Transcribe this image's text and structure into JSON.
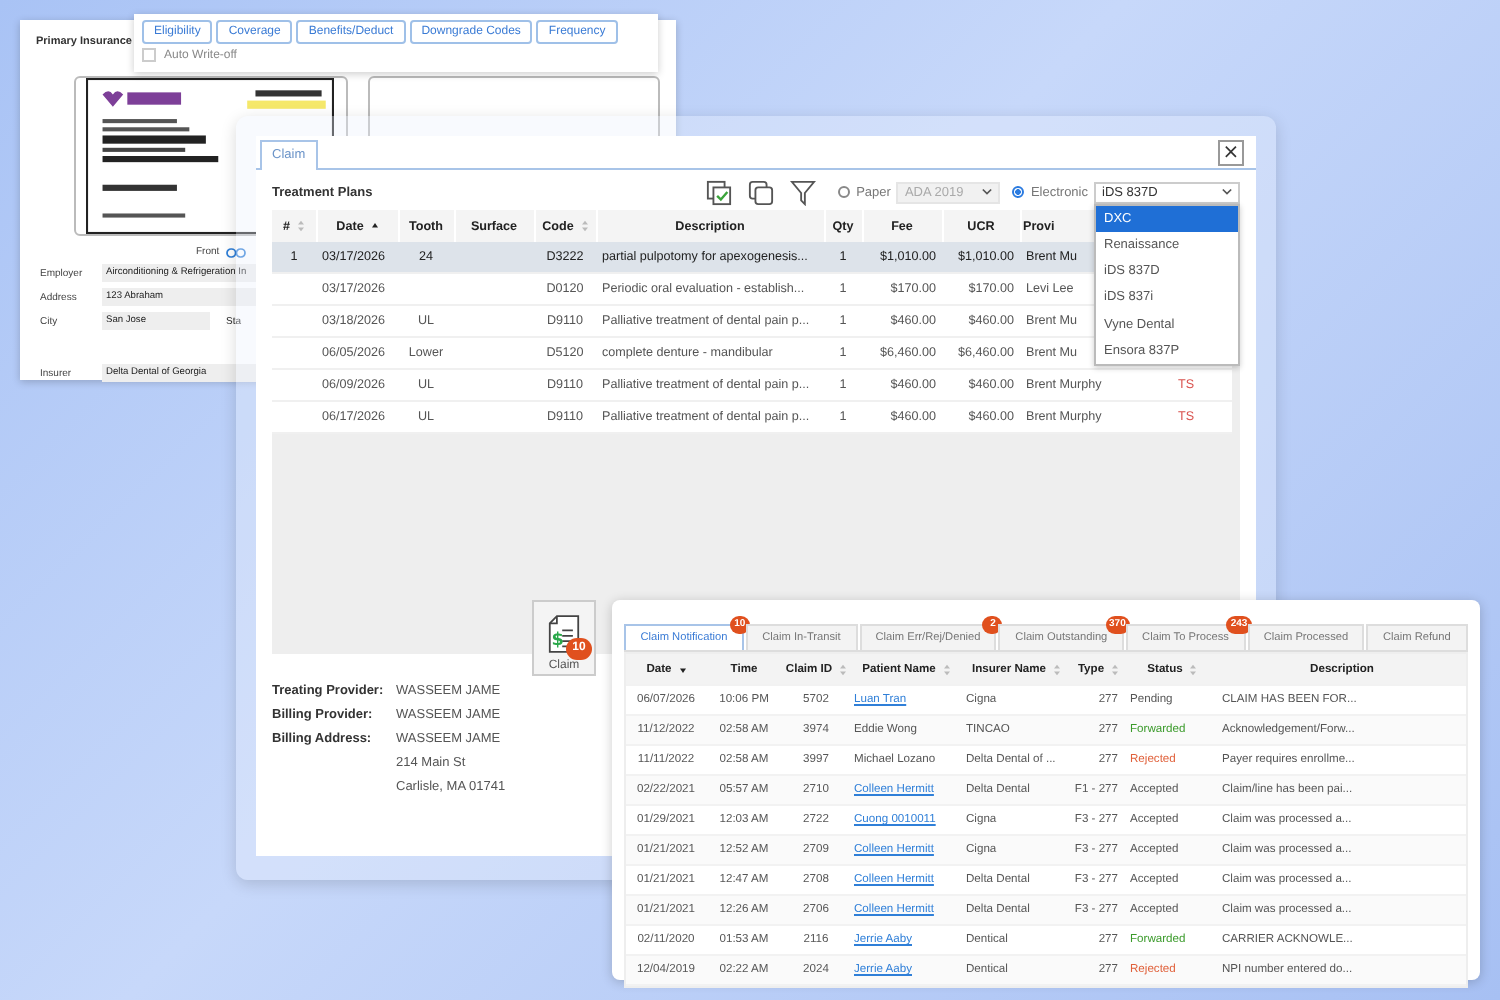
{
  "insurance": {
    "title": "Primary Insurance",
    "card_side": "Front",
    "fields": [
      {
        "label": "Employer",
        "value": "Airconditioning & Refrigeration In"
      },
      {
        "label": "Address",
        "value": "123 Abraham"
      },
      {
        "label": "City",
        "value": "San Jose",
        "extra_label": "Sta"
      },
      {
        "label": "Insurer",
        "value": "Delta Dental of Georgia"
      }
    ]
  },
  "toolbar": {
    "buttons": [
      "Eligibility",
      "Coverage",
      "Benefits/Deduct",
      "Downgrade Codes",
      "Frequency"
    ],
    "auto_writeoff": {
      "label": "Auto Write-off",
      "checked": false
    }
  },
  "claim_dialog": {
    "tab": {
      "label": "Claim",
      "selected": true
    },
    "close": "×",
    "section_title": "Treatment Plans",
    "format": [
      {
        "label": "Paper",
        "selected": false,
        "select": "ADA 2019"
      },
      {
        "label": "Electronic",
        "selected": true,
        "select": "iDS 837D"
      }
    ],
    "dropdown": [
      {
        "label": "DXC",
        "selected": true
      },
      {
        "label": "Renaissance",
        "selected": false
      },
      {
        "label": "iDS 837D",
        "selected": false
      },
      {
        "label": "iDS 837i",
        "selected": false
      },
      {
        "label": "Vyne Dental",
        "selected": false
      },
      {
        "label": "Ensora 837P",
        "selected": false
      }
    ],
    "columns": [
      "#",
      "Date",
      "Tooth",
      "Surface",
      "Code",
      "Description",
      "Qty",
      "Fee",
      "UCR",
      "Provi"
    ],
    "rows": [
      {
        "selected": true,
        "cells": [
          "1",
          "03/17/2026",
          "24",
          "",
          "D3222",
          "partial pulpotomy for apexogenesis...",
          "1",
          "$1,010.00",
          "$1,010.00",
          "Brent Mu",
          ""
        ]
      },
      {
        "selected": false,
        "cells": [
          "",
          "03/17/2026",
          "",
          "",
          "D0120",
          "Periodic oral evaluation - establish...",
          "1",
          "$170.00",
          "$170.00",
          "Levi Lee",
          ""
        ]
      },
      {
        "selected": false,
        "cells": [
          "",
          "03/18/2026",
          "UL",
          "",
          "D9110",
          "Palliative treatment of dental pain p...",
          "1",
          "$460.00",
          "$460.00",
          "Brent Mu",
          ""
        ]
      },
      {
        "selected": false,
        "cells": [
          "",
          "06/05/2026",
          "Lower",
          "",
          "D5120",
          "complete denture - mandibular",
          "1",
          "$6,460.00",
          "$6,460.00",
          "Brent Mu",
          ""
        ]
      },
      {
        "selected": false,
        "cells": [
          "",
          "06/09/2026",
          "UL",
          "",
          "D9110",
          "Palliative treatment of dental pain p...",
          "1",
          "$460.00",
          "$460.00",
          "Brent Murphy",
          "TS"
        ]
      },
      {
        "selected": false,
        "cells": [
          "",
          "06/17/2026",
          "UL",
          "",
          "D9110",
          "Palliative treatment of dental pain p...",
          "1",
          "$460.00",
          "$460.00",
          "Brent Murphy",
          "TS"
        ]
      }
    ],
    "claim_button": {
      "label": "Claim",
      "badge": "10",
      "icon_mark": "$"
    },
    "provider_info": [
      {
        "label": "Treating Provider:",
        "lines": [
          "WASSEEM JAME"
        ]
      },
      {
        "label": "Billing Provider:",
        "lines": [
          "WASSEEM JAME"
        ]
      },
      {
        "label": "Billing Address:",
        "lines": [
          "WASSEEM JAME",
          "214 Main St",
          "Carlisle, MA 01741"
        ]
      }
    ]
  },
  "claims": {
    "tabs": [
      {
        "label": "Claim Notification",
        "badge": "10",
        "selected": true
      },
      {
        "label": "Claim In-Transit",
        "selected": false
      },
      {
        "label": "Claim Err/Rej/Denied",
        "badge": "2",
        "selected": false
      },
      {
        "label": "Claim Outstanding",
        "badge": "370",
        "selected": false
      },
      {
        "label": "Claim To Process",
        "badge": "243",
        "selected": false
      },
      {
        "label": "Claim Processed",
        "selected": false
      },
      {
        "label": "Claim Refund",
        "selected": false
      }
    ],
    "columns": [
      "Date",
      "Time",
      "Claim ID",
      "Patient Name",
      "Insurer Name",
      "Type",
      "Status",
      "Description"
    ],
    "rows": [
      {
        "date": "06/07/2026",
        "time": "10:06 PM",
        "id": "5702",
        "patient": "Luan Tran",
        "linked": true,
        "insurer": "Cigna",
        "type": "277",
        "status": "Pending",
        "color": "#555555",
        "description": "CLAIM HAS BEEN FOR..."
      },
      {
        "date": "11/12/2022",
        "time": "02:58 AM",
        "id": "3974",
        "patient": "Eddie Wong",
        "linked": false,
        "insurer": "TINCAO",
        "type": "277",
        "status": "Forwarded",
        "color": "#3a9a2a",
        "description": "Acknowledgement/Forw..."
      },
      {
        "date": "11/11/2022",
        "time": "02:58 AM",
        "id": "3997",
        "patient": "Michael Lozano",
        "linked": false,
        "insurer": "Delta Dental of ...",
        "type": "277",
        "status": "Rejected",
        "color": "#e0603a",
        "description": "Payer requires enrollme..."
      },
      {
        "date": "02/22/2021",
        "time": "05:57 AM",
        "id": "2710",
        "patient": "Colleen Hermitt",
        "linked": true,
        "insurer": "Delta Dental",
        "type": "F1 - 277",
        "status": "Accepted",
        "color": "#555555",
        "description": "Claim/line has been pai..."
      },
      {
        "date": "01/29/2021",
        "time": "12:03 AM",
        "id": "2722",
        "patient": "Cuong 0010011",
        "linked": true,
        "insurer": "Cigna",
        "type": "F3 - 277",
        "status": "Accepted",
        "color": "#555555",
        "description": "Claim was processed a..."
      },
      {
        "date": "01/21/2021",
        "time": "12:52 AM",
        "id": "2709",
        "patient": "Colleen Hermitt",
        "linked": true,
        "insurer": "Cigna",
        "type": "F3 - 277",
        "status": "Accepted",
        "color": "#555555",
        "description": "Claim was processed a..."
      },
      {
        "date": "01/21/2021",
        "time": "12:47 AM",
        "id": "2708",
        "patient": "Colleen Hermitt",
        "linked": true,
        "insurer": "Delta Dental",
        "type": "F3 - 277",
        "status": "Accepted",
        "color": "#555555",
        "description": "Claim was processed a..."
      },
      {
        "date": "01/21/2021",
        "time": "12:26 AM",
        "id": "2706",
        "patient": "Colleen Hermitt",
        "linked": true,
        "insurer": "Delta Dental",
        "type": "F3 - 277",
        "status": "Accepted",
        "color": "#555555",
        "description": "Claim was processed a..."
      },
      {
        "date": "02/11/2020",
        "time": "01:53 AM",
        "id": "2116",
        "patient": "Jerrie Aaby",
        "linked": true,
        "insurer": "Dentical",
        "type": "277",
        "status": "Forwarded",
        "color": "#3a9a2a",
        "description": "CARRIER ACKNOWLE..."
      },
      {
        "date": "12/04/2019",
        "time": "02:22 AM",
        "id": "2024",
        "patient": "Jerrie Aaby",
        "linked": true,
        "insurer": "Dentical",
        "type": "277",
        "status": "Rejected",
        "color": "#e0603a",
        "description": "NPI number entered do..."
      }
    ]
  }
}
